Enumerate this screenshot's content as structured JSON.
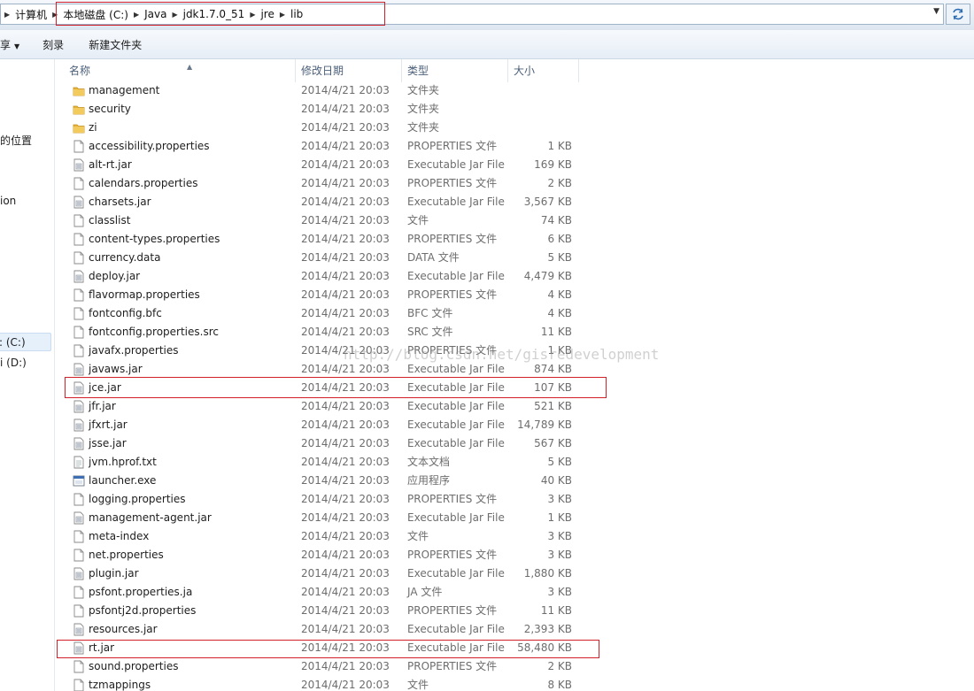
{
  "address_bar": {
    "breadcrumbs": [
      "计算机",
      "本地磁盘 (C:)",
      "Java",
      "jdk1.7.0_51",
      "jre",
      "lib"
    ]
  },
  "toolbar": {
    "share_label": "享",
    "burn_label": "刻录",
    "new_folder_label": "新建文件夹"
  },
  "nav": {
    "items": [
      {
        "label": "的位置"
      },
      {
        "label": "ion"
      },
      {
        "label": ": (C:)"
      },
      {
        "label": "i (D:)"
      }
    ]
  },
  "columns": {
    "name": "名称",
    "date": "修改日期",
    "type": "类型",
    "size": "大小"
  },
  "files": [
    {
      "name": "management",
      "date": "2014/4/21 20:03",
      "type": "文件夹",
      "size": "",
      "icon": "folder-icon"
    },
    {
      "name": "security",
      "date": "2014/4/21 20:03",
      "type": "文件夹",
      "size": "",
      "icon": "folder-icon"
    },
    {
      "name": "zi",
      "date": "2014/4/21 20:03",
      "type": "文件夹",
      "size": "",
      "icon": "folder-icon"
    },
    {
      "name": "accessibility.properties",
      "date": "2014/4/21 20:03",
      "type": "PROPERTIES 文件",
      "size": "1 KB",
      "icon": "file-icon"
    },
    {
      "name": "alt-rt.jar",
      "date": "2014/4/21 20:03",
      "type": "Executable Jar File",
      "size": "169 KB",
      "icon": "jar-icon"
    },
    {
      "name": "calendars.properties",
      "date": "2014/4/21 20:03",
      "type": "PROPERTIES 文件",
      "size": "2 KB",
      "icon": "file-icon"
    },
    {
      "name": "charsets.jar",
      "date": "2014/4/21 20:03",
      "type": "Executable Jar File",
      "size": "3,567 KB",
      "icon": "jar-icon"
    },
    {
      "name": "classlist",
      "date": "2014/4/21 20:03",
      "type": "文件",
      "size": "74 KB",
      "icon": "file-icon"
    },
    {
      "name": "content-types.properties",
      "date": "2014/4/21 20:03",
      "type": "PROPERTIES 文件",
      "size": "6 KB",
      "icon": "file-icon"
    },
    {
      "name": "currency.data",
      "date": "2014/4/21 20:03",
      "type": "DATA 文件",
      "size": "5 KB",
      "icon": "file-icon"
    },
    {
      "name": "deploy.jar",
      "date": "2014/4/21 20:03",
      "type": "Executable Jar File",
      "size": "4,479 KB",
      "icon": "jar-icon"
    },
    {
      "name": "flavormap.properties",
      "date": "2014/4/21 20:03",
      "type": "PROPERTIES 文件",
      "size": "4 KB",
      "icon": "file-icon"
    },
    {
      "name": "fontconfig.bfc",
      "date": "2014/4/21 20:03",
      "type": "BFC 文件",
      "size": "4 KB",
      "icon": "file-icon"
    },
    {
      "name": "fontconfig.properties.src",
      "date": "2014/4/21 20:03",
      "type": "SRC 文件",
      "size": "11 KB",
      "icon": "file-icon"
    },
    {
      "name": "javafx.properties",
      "date": "2014/4/21 20:03",
      "type": "PROPERTIES 文件",
      "size": "1 KB",
      "icon": "file-icon"
    },
    {
      "name": "javaws.jar",
      "date": "2014/4/21 20:03",
      "type": "Executable Jar File",
      "size": "874 KB",
      "icon": "jar-icon"
    },
    {
      "name": "jce.jar",
      "date": "2014/4/21 20:03",
      "type": "Executable Jar File",
      "size": "107 KB",
      "icon": "jar-icon"
    },
    {
      "name": "jfr.jar",
      "date": "2014/4/21 20:03",
      "type": "Executable Jar File",
      "size": "521 KB",
      "icon": "jar-icon"
    },
    {
      "name": "jfxrt.jar",
      "date": "2014/4/21 20:03",
      "type": "Executable Jar File",
      "size": "14,789 KB",
      "icon": "jar-icon"
    },
    {
      "name": "jsse.jar",
      "date": "2014/4/21 20:03",
      "type": "Executable Jar File",
      "size": "567 KB",
      "icon": "jar-icon"
    },
    {
      "name": "jvm.hprof.txt",
      "date": "2014/4/21 20:03",
      "type": "文本文档",
      "size": "5 KB",
      "icon": "text-file-icon"
    },
    {
      "name": "launcher.exe",
      "date": "2014/4/21 20:03",
      "type": "应用程序",
      "size": "40 KB",
      "icon": "exe-icon"
    },
    {
      "name": "logging.properties",
      "date": "2014/4/21 20:03",
      "type": "PROPERTIES 文件",
      "size": "3 KB",
      "icon": "file-icon"
    },
    {
      "name": "management-agent.jar",
      "date": "2014/4/21 20:03",
      "type": "Executable Jar File",
      "size": "1 KB",
      "icon": "jar-icon"
    },
    {
      "name": "meta-index",
      "date": "2014/4/21 20:03",
      "type": "文件",
      "size": "3 KB",
      "icon": "file-icon"
    },
    {
      "name": "net.properties",
      "date": "2014/4/21 20:03",
      "type": "PROPERTIES 文件",
      "size": "3 KB",
      "icon": "file-icon"
    },
    {
      "name": "plugin.jar",
      "date": "2014/4/21 20:03",
      "type": "Executable Jar File",
      "size": "1,880 KB",
      "icon": "jar-icon"
    },
    {
      "name": "psfont.properties.ja",
      "date": "2014/4/21 20:03",
      "type": "JA 文件",
      "size": "3 KB",
      "icon": "file-icon"
    },
    {
      "name": "psfontj2d.properties",
      "date": "2014/4/21 20:03",
      "type": "PROPERTIES 文件",
      "size": "11 KB",
      "icon": "file-icon"
    },
    {
      "name": "resources.jar",
      "date": "2014/4/21 20:03",
      "type": "Executable Jar File",
      "size": "2,393 KB",
      "icon": "jar-icon"
    },
    {
      "name": "rt.jar",
      "date": "2014/4/21 20:03",
      "type": "Executable Jar File",
      "size": "58,480 KB",
      "icon": "jar-icon"
    },
    {
      "name": "sound.properties",
      "date": "2014/4/21 20:03",
      "type": "PROPERTIES 文件",
      "size": "2 KB",
      "icon": "file-icon"
    },
    {
      "name": "tzmappings",
      "date": "2014/4/21 20:03",
      "type": "文件",
      "size": "8 KB",
      "icon": "file-icon"
    }
  ],
  "watermark": "http://blog.csdn.net/gisredevelopment",
  "colors": {
    "highlight": "#d2202a",
    "folder": "#e8b437",
    "header_text": "#4c607a"
  }
}
